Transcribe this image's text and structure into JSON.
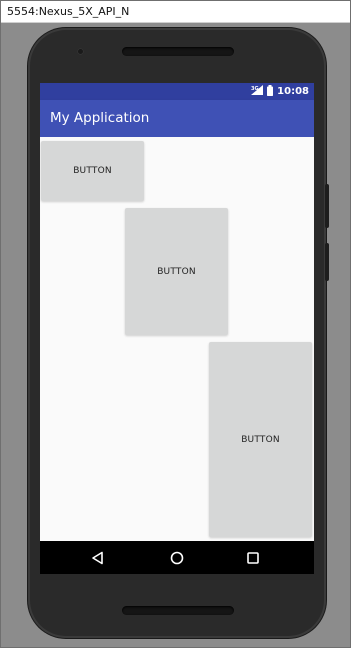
{
  "window": {
    "title": "5554:Nexus_5X_API_N"
  },
  "statusbar": {
    "time": "10:08",
    "signal_icon": "signal-icon",
    "battery_icon": "battery-icon",
    "color": "#303f9f"
  },
  "appbar": {
    "title": "My Application",
    "color": "#3f51b5"
  },
  "buttons": [
    {
      "label": "BUTTON"
    },
    {
      "label": "BUTTON"
    },
    {
      "label": "BUTTON"
    }
  ],
  "navbar": {
    "back_icon": "back-triangle-icon",
    "home_icon": "home-circle-icon",
    "recents_icon": "recents-square-icon"
  }
}
